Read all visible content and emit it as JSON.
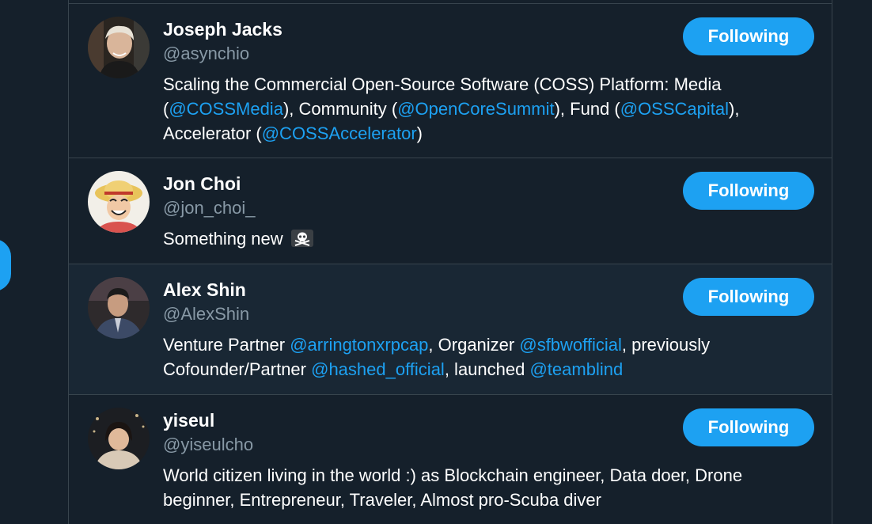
{
  "colors": {
    "background": "#15202b",
    "cell_hover": "#192734",
    "border": "#38444d",
    "accent": "#1da1f2",
    "text": "#ffffff",
    "muted": "#8899a6"
  },
  "users": [
    {
      "name": "Joseph Jacks",
      "handle": "@asynchio",
      "button_label": "Following",
      "bio": [
        {
          "text": "Scaling the Commercial Open-Source Software (COSS) Platform: Media ("
        },
        {
          "text": "@COSSMedia",
          "mention": true
        },
        {
          "text": "), Community ("
        },
        {
          "text": "@OpenCoreSummit",
          "mention": true
        },
        {
          "text": "), Fund ("
        },
        {
          "text": "@OSSCapital",
          "mention": true
        },
        {
          "text": "), Accelerator ("
        },
        {
          "text": "@COSSAccelerator",
          "mention": true
        },
        {
          "text": ")"
        }
      ]
    },
    {
      "name": "Jon Choi",
      "handle": "@jon_choi_",
      "button_label": "Following",
      "bio_text": "Something new",
      "bio_emoji_icon": "skull-crossbones-icon"
    },
    {
      "name": "Alex Shin",
      "handle": "@AlexShin",
      "button_label": "Following",
      "bio": [
        {
          "text": "Venture Partner "
        },
        {
          "text": "@arringtonxrpcap",
          "mention": true
        },
        {
          "text": ", Organizer "
        },
        {
          "text": "@sfbwofficial",
          "mention": true
        },
        {
          "text": ", previously Cofounder/Partner "
        },
        {
          "text": "@hashed_official",
          "mention": true
        },
        {
          "text": ", launched "
        },
        {
          "text": "@teamblind",
          "mention": true
        }
      ]
    },
    {
      "name": "yiseul",
      "handle": "@yiseulcho",
      "button_label": "Following",
      "bio_text": "World citizen living in the world :) as Blockchain engineer, Data doer, Drone beginner, Entrepreneur, Traveler, Almost pro-Scuba diver"
    }
  ]
}
